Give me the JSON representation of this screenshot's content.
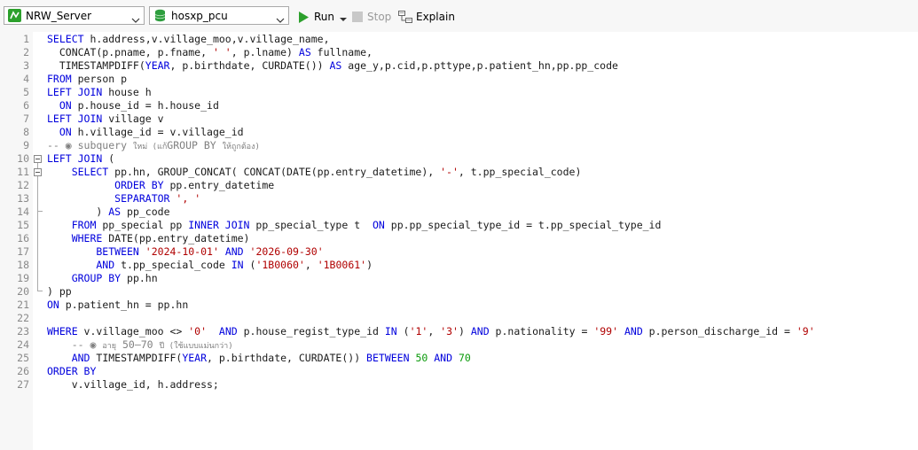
{
  "toolbar": {
    "connection": "NRW_Server",
    "database": "hosxp_pcu",
    "run_label": "Run",
    "stop_label": "Stop",
    "explain_label": "Explain"
  },
  "editor": {
    "line_numbers": [
      "1",
      "2",
      "3",
      "4",
      "5",
      "6",
      "7",
      "8",
      "9",
      "10",
      "11",
      "12",
      "13",
      "14",
      "15",
      "16",
      "17",
      "18",
      "19",
      "20",
      "21",
      "22",
      "23",
      "24",
      "25",
      "26",
      "27"
    ],
    "lines": [
      [
        {
          "t": "SELECT",
          "c": "kw"
        },
        {
          "t": " h.address,v.village_moo,v.village_name,",
          "c": "fn"
        }
      ],
      [
        {
          "t": "  CONCAT(p.pname, p.fname, ",
          "c": "fn"
        },
        {
          "t": "' '",
          "c": "str"
        },
        {
          "t": ", p.lname) ",
          "c": "fn"
        },
        {
          "t": "AS",
          "c": "kw"
        },
        {
          "t": " fullname,",
          "c": "fn"
        }
      ],
      [
        {
          "t": "  TIMESTAMPDIFF(",
          "c": "fn"
        },
        {
          "t": "YEAR",
          "c": "kw"
        },
        {
          "t": ", p.birthdate, CURDATE()) ",
          "c": "fn"
        },
        {
          "t": "AS",
          "c": "kw"
        },
        {
          "t": " age_y,p.cid,p.pttype,p.patient_hn,pp.pp_code",
          "c": "fn"
        }
      ],
      [
        {
          "t": "FROM",
          "c": "kw"
        },
        {
          "t": " person p",
          "c": "fn"
        }
      ],
      [
        {
          "t": "LEFT JOIN",
          "c": "kw"
        },
        {
          "t": " house h",
          "c": "fn"
        }
      ],
      [
        {
          "t": "  ON",
          "c": "kw"
        },
        {
          "t": " p.house_id = h.house_id",
          "c": "fn"
        }
      ],
      [
        {
          "t": "LEFT JOIN",
          "c": "kw"
        },
        {
          "t": " village v",
          "c": "fn"
        }
      ],
      [
        {
          "t": "  ON",
          "c": "kw"
        },
        {
          "t": " h.village_id = v.village_id",
          "c": "fn"
        }
      ],
      [
        {
          "t": "-- ◉ subquery ",
          "c": "cm"
        },
        {
          "t": "ใหม่ (แก้",
          "c": "cm-small"
        },
        {
          "t": "GROUP BY ",
          "c": "cm"
        },
        {
          "t": "ให้ถูกต้อง)",
          "c": "cm-small"
        }
      ],
      [
        {
          "t": "LEFT JOIN",
          "c": "kw"
        },
        {
          "t": " (",
          "c": "fn"
        }
      ],
      [
        {
          "t": "    SELECT",
          "c": "kw"
        },
        {
          "t": " pp.hn, GROUP_CONCAT( CONCAT(DATE(pp.entry_datetime), ",
          "c": "fn"
        },
        {
          "t": "'-'",
          "c": "str"
        },
        {
          "t": ", t.pp_special_code)",
          "c": "fn"
        }
      ],
      [
        {
          "t": "           ORDER BY",
          "c": "kw"
        },
        {
          "t": " pp.entry_datetime",
          "c": "fn"
        }
      ],
      [
        {
          "t": "           SEPARATOR",
          "c": "kw"
        },
        {
          "t": " ",
          "c": "fn"
        },
        {
          "t": "', '",
          "c": "str"
        }
      ],
      [
        {
          "t": "        ) ",
          "c": "fn"
        },
        {
          "t": "AS",
          "c": "kw"
        },
        {
          "t": " pp_code",
          "c": "fn"
        }
      ],
      [
        {
          "t": "    FROM",
          "c": "kw"
        },
        {
          "t": " pp_special pp ",
          "c": "fn"
        },
        {
          "t": "INNER JOIN",
          "c": "kw"
        },
        {
          "t": " pp_special_type t  ",
          "c": "fn"
        },
        {
          "t": "ON",
          "c": "kw"
        },
        {
          "t": " pp.pp_special_type_id = t.pp_special_type_id",
          "c": "fn"
        }
      ],
      [
        {
          "t": "    WHERE",
          "c": "kw"
        },
        {
          "t": " DATE(pp.entry_datetime)",
          "c": "fn"
        }
      ],
      [
        {
          "t": "        BETWEEN",
          "c": "kw"
        },
        {
          "t": " ",
          "c": "fn"
        },
        {
          "t": "'2024-10-01'",
          "c": "str"
        },
        {
          "t": " ",
          "c": "fn"
        },
        {
          "t": "AND",
          "c": "kw"
        },
        {
          "t": " ",
          "c": "fn"
        },
        {
          "t": "'2026-09-30'",
          "c": "str"
        }
      ],
      [
        {
          "t": "        AND",
          "c": "kw"
        },
        {
          "t": " t.pp_special_code ",
          "c": "fn"
        },
        {
          "t": "IN",
          "c": "kw"
        },
        {
          "t": " (",
          "c": "fn"
        },
        {
          "t": "'1B0060'",
          "c": "str"
        },
        {
          "t": ", ",
          "c": "fn"
        },
        {
          "t": "'1B0061'",
          "c": "str"
        },
        {
          "t": ")",
          "c": "fn"
        }
      ],
      [
        {
          "t": "    GROUP BY",
          "c": "kw"
        },
        {
          "t": " pp.hn",
          "c": "fn"
        }
      ],
      [
        {
          "t": ") pp",
          "c": "fn"
        }
      ],
      [
        {
          "t": "ON",
          "c": "kw"
        },
        {
          "t": " p.patient_hn = pp.hn",
          "c": "fn"
        }
      ],
      [],
      [
        {
          "t": "WHERE",
          "c": "kw"
        },
        {
          "t": " v.village_moo <> ",
          "c": "fn"
        },
        {
          "t": "'0'",
          "c": "str"
        },
        {
          "t": "  ",
          "c": "fn"
        },
        {
          "t": "AND",
          "c": "kw"
        },
        {
          "t": " p.house_regist_type_id ",
          "c": "fn"
        },
        {
          "t": "IN",
          "c": "kw"
        },
        {
          "t": " (",
          "c": "fn"
        },
        {
          "t": "'1'",
          "c": "str"
        },
        {
          "t": ", ",
          "c": "fn"
        },
        {
          "t": "'3'",
          "c": "str"
        },
        {
          "t": ") ",
          "c": "fn"
        },
        {
          "t": "AND",
          "c": "kw"
        },
        {
          "t": " p.nationality = ",
          "c": "fn"
        },
        {
          "t": "'99'",
          "c": "str"
        },
        {
          "t": " ",
          "c": "fn"
        },
        {
          "t": "AND",
          "c": "kw"
        },
        {
          "t": " p.person_discharge_id = ",
          "c": "fn"
        },
        {
          "t": "'9'",
          "c": "str"
        }
      ],
      [
        {
          "t": "    -- ◉ ",
          "c": "cm"
        },
        {
          "t": "อายุ",
          "c": "cm-small"
        },
        {
          "t": " 50–70 ",
          "c": "cm"
        },
        {
          "t": "ปี (ใช้แบบแม่นกว่า)",
          "c": "cm-small"
        }
      ],
      [
        {
          "t": "    AND",
          "c": "kw"
        },
        {
          "t": " TIMESTAMPDIFF(",
          "c": "fn"
        },
        {
          "t": "YEAR",
          "c": "kw"
        },
        {
          "t": ", p.birthdate, CURDATE()) ",
          "c": "fn"
        },
        {
          "t": "BETWEEN",
          "c": "kw"
        },
        {
          "t": " ",
          "c": "fn"
        },
        {
          "t": "50",
          "c": "num"
        },
        {
          "t": " ",
          "c": "fn"
        },
        {
          "t": "AND",
          "c": "kw"
        },
        {
          "t": " ",
          "c": "fn"
        },
        {
          "t": "70",
          "c": "num"
        }
      ],
      [
        {
          "t": "ORDER BY",
          "c": "kw"
        }
      ],
      [
        {
          "t": "    v.village_id, h.address;",
          "c": "fn"
        }
      ]
    ]
  },
  "colors": {
    "accent_green": "#2ca02c",
    "keyword": "#0000dd",
    "string": "#b00000",
    "number": "#0a9a0a",
    "comment": "#808080"
  }
}
